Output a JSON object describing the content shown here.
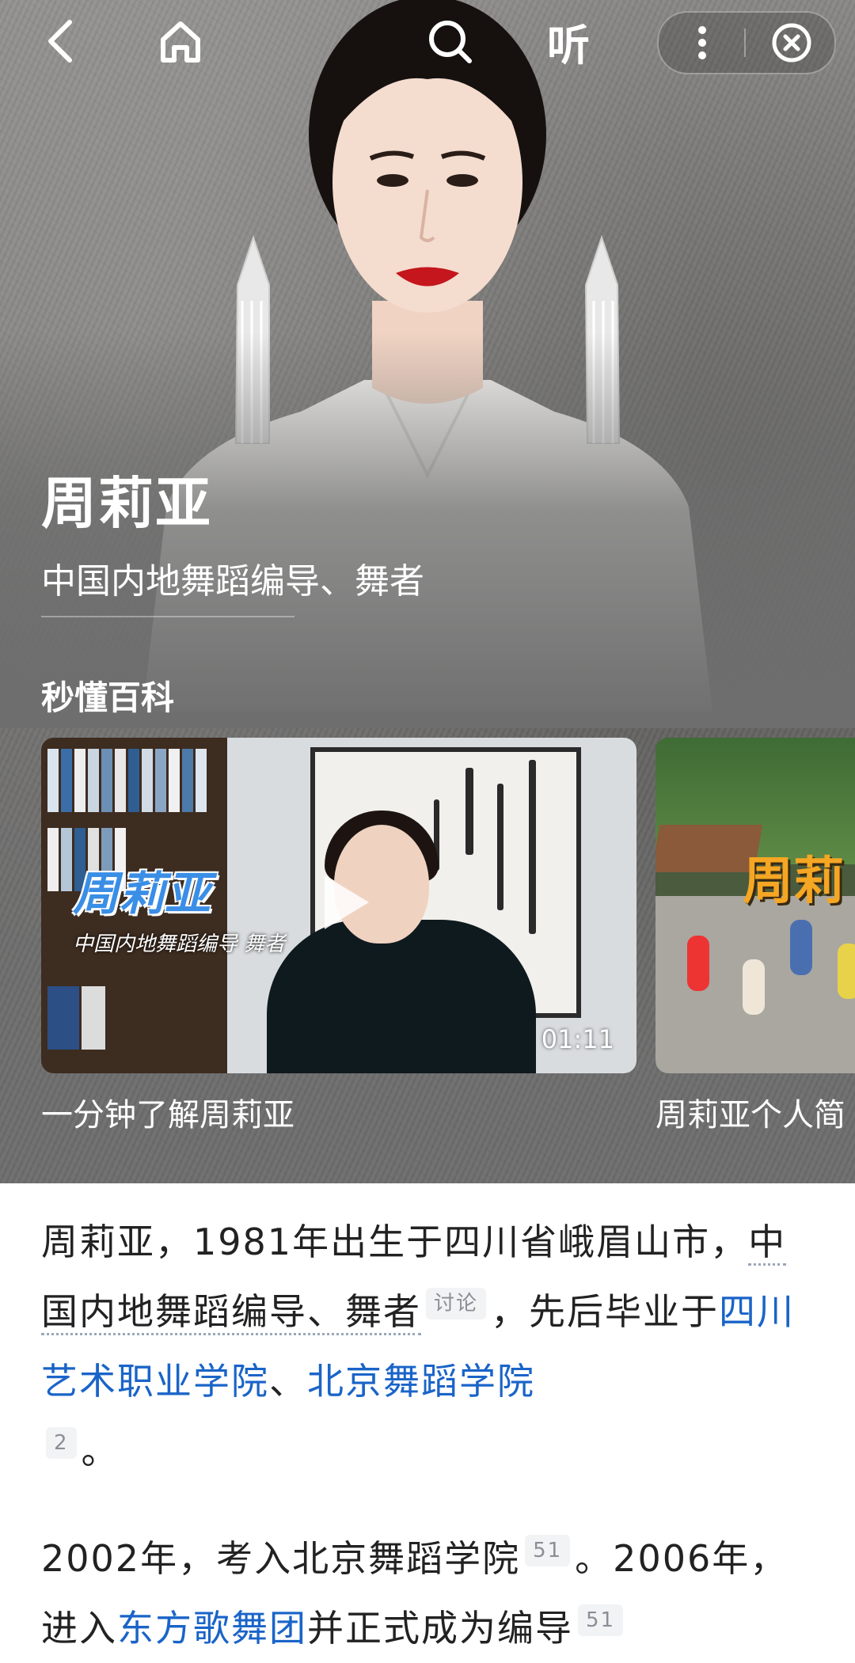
{
  "topbar": {
    "listen_label": "听"
  },
  "profile": {
    "name": "周莉亚",
    "subtitle": "中国内地舞蹈编导、舞者"
  },
  "section": {
    "title": "秒懂百科"
  },
  "videos": [
    {
      "caption": "一分钟了解周莉亚",
      "duration": "01:11",
      "overlay_title": "周莉亚",
      "overlay_subtitle": "中国内地舞蹈编导 舞者"
    },
    {
      "caption": "周莉亚个人简",
      "overlay_title": "周莉"
    }
  ],
  "article": {
    "p1_a": "周莉亚，1981年出生于四川省峨眉山市，",
    "p1_term": "中国内地舞蹈编导、舞者",
    "p1_tag": "讨论",
    "p1_b": "，先后毕业于",
    "p1_link1": "四川艺术职业学院",
    "p1_sep": "、",
    "p1_link2": "北京舞蹈学院",
    "p1_ref": "2",
    "p1_end": "。",
    "p2_a": "2002年，考入北京舞蹈学院",
    "p2_ref1": "51",
    "p2_b": "。2006年，进入",
    "p2_link": "东方歌舞团",
    "p2_c": "并正式成为编导",
    "p2_ref2": "51"
  },
  "icons": {
    "back": "back-arrow-icon",
    "home": "home-icon",
    "search": "search-icon",
    "more": "more-vertical-icon",
    "close": "close-circle-icon",
    "play": "play-icon"
  },
  "colors": {
    "link": "#1a64c8",
    "hero_bg": "#7f7e7c"
  }
}
